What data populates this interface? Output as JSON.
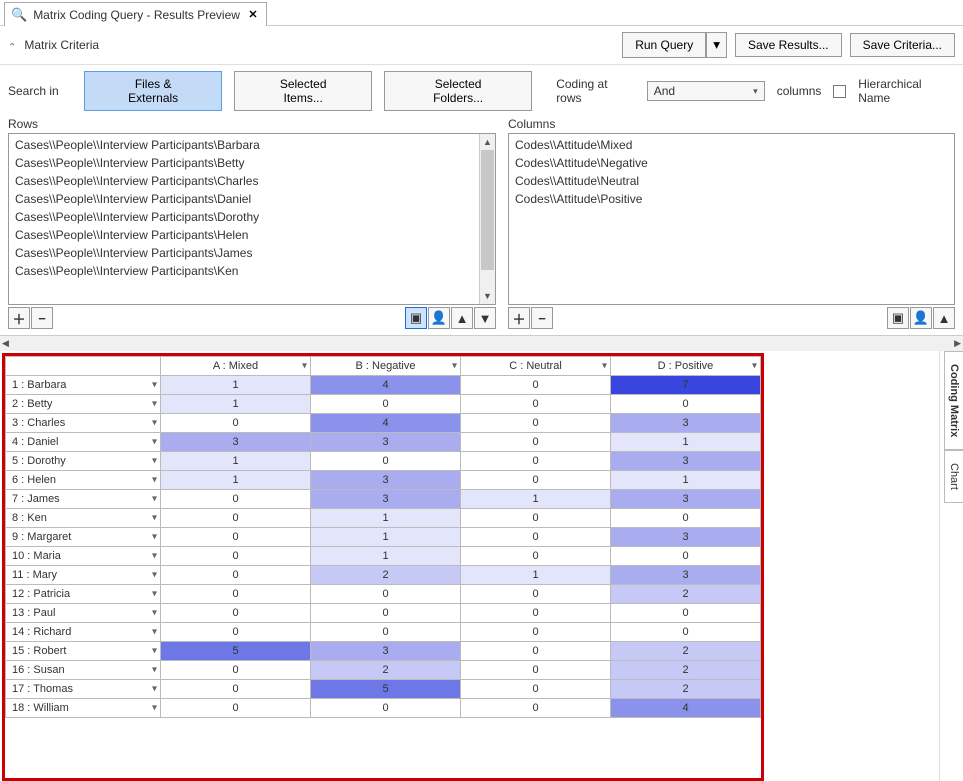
{
  "tab": {
    "title": "Matrix Coding Query - Results Preview"
  },
  "criteria": {
    "title": "Matrix Criteria"
  },
  "buttons": {
    "run_query": "Run Query",
    "save_results": "Save Results...",
    "save_criteria": "Save Criteria..."
  },
  "search": {
    "label": "Search in",
    "files": "Files & Externals",
    "selected_items": "Selected Items...",
    "selected_folders": "Selected Folders...",
    "coding_at_rows": "Coding at rows",
    "and": "And",
    "columns_word": "columns",
    "hierarchical_name": "Hierarchical Name"
  },
  "rows_title": "Rows",
  "cols_title": "Columns",
  "rows": [
    "Cases\\\\People\\\\Interview Participants\\Barbara",
    "Cases\\\\People\\\\Interview Participants\\Betty",
    "Cases\\\\People\\\\Interview Participants\\Charles",
    "Cases\\\\People\\\\Interview Participants\\Daniel",
    "Cases\\\\People\\\\Interview Participants\\Dorothy",
    "Cases\\\\People\\\\Interview Participants\\Helen",
    "Cases\\\\People\\\\Interview Participants\\James",
    "Cases\\\\People\\\\Interview Participants\\Ken"
  ],
  "cols": [
    "Codes\\\\Attitude\\Mixed",
    "Codes\\\\Attitude\\Negative",
    "Codes\\\\Attitude\\Neutral",
    "Codes\\\\Attitude\\Positive"
  ],
  "matrix": {
    "corner": "",
    "headers": [
      "A : Mixed",
      "B : Negative",
      "C : Neutral",
      "D : Positive"
    ],
    "row_labels": [
      "1 : Barbara",
      "2 : Betty",
      "3 : Charles",
      "4 : Daniel",
      "5 : Dorothy",
      "6 : Helen",
      "7 : James",
      "8 : Ken",
      "9 : Margaret",
      "10 : Maria",
      "11 : Mary",
      "12 : Patricia",
      "13 : Paul",
      "14 : Richard",
      "15 : Robert",
      "16 : Susan",
      "17 : Thomas",
      "18 : William"
    ],
    "cells": [
      [
        {
          "v": 1,
          "s": 1
        },
        {
          "v": 4,
          "s": 4
        },
        {
          "v": 0,
          "s": 0
        },
        {
          "v": 7,
          "s": 7
        }
      ],
      [
        {
          "v": 1,
          "s": 1
        },
        {
          "v": 0,
          "s": 0
        },
        {
          "v": 0,
          "s": 0
        },
        {
          "v": 0,
          "s": 0
        }
      ],
      [
        {
          "v": 0,
          "s": 0
        },
        {
          "v": 4,
          "s": 4
        },
        {
          "v": 0,
          "s": 0
        },
        {
          "v": 3,
          "s": 3
        }
      ],
      [
        {
          "v": 3,
          "s": 3
        },
        {
          "v": 3,
          "s": 3
        },
        {
          "v": 0,
          "s": 0
        },
        {
          "v": 1,
          "s": 1
        }
      ],
      [
        {
          "v": 1,
          "s": 1
        },
        {
          "v": 0,
          "s": 0
        },
        {
          "v": 0,
          "s": 0
        },
        {
          "v": 3,
          "s": 3
        }
      ],
      [
        {
          "v": 1,
          "s": 1
        },
        {
          "v": 3,
          "s": 3
        },
        {
          "v": 0,
          "s": 0
        },
        {
          "v": 1,
          "s": 1
        }
      ],
      [
        {
          "v": 0,
          "s": 0
        },
        {
          "v": 3,
          "s": 3
        },
        {
          "v": 1,
          "s": 1
        },
        {
          "v": 3,
          "s": 3
        }
      ],
      [
        {
          "v": 0,
          "s": 0
        },
        {
          "v": 1,
          "s": 1
        },
        {
          "v": 0,
          "s": 0
        },
        {
          "v": 0,
          "s": 0
        }
      ],
      [
        {
          "v": 0,
          "s": 0
        },
        {
          "v": 1,
          "s": 1
        },
        {
          "v": 0,
          "s": 0
        },
        {
          "v": 3,
          "s": 3
        }
      ],
      [
        {
          "v": 0,
          "s": 0
        },
        {
          "v": 1,
          "s": 1
        },
        {
          "v": 0,
          "s": 0
        },
        {
          "v": 0,
          "s": 0
        }
      ],
      [
        {
          "v": 0,
          "s": 0
        },
        {
          "v": 2,
          "s": 2
        },
        {
          "v": 1,
          "s": 1
        },
        {
          "v": 3,
          "s": 3
        }
      ],
      [
        {
          "v": 0,
          "s": 0
        },
        {
          "v": 0,
          "s": 0
        },
        {
          "v": 0,
          "s": 0
        },
        {
          "v": 2,
          "s": 2
        }
      ],
      [
        {
          "v": 0,
          "s": 0
        },
        {
          "v": 0,
          "s": 0
        },
        {
          "v": 0,
          "s": 0
        },
        {
          "v": 0,
          "s": 0
        }
      ],
      [
        {
          "v": 0,
          "s": 0
        },
        {
          "v": 0,
          "s": 0
        },
        {
          "v": 0,
          "s": 0
        },
        {
          "v": 0,
          "s": 0
        }
      ],
      [
        {
          "v": 5,
          "s": 5
        },
        {
          "v": 3,
          "s": 3
        },
        {
          "v": 0,
          "s": 0
        },
        {
          "v": 2,
          "s": 2
        }
      ],
      [
        {
          "v": 0,
          "s": 0
        },
        {
          "v": 2,
          "s": 2
        },
        {
          "v": 0,
          "s": 0
        },
        {
          "v": 2,
          "s": 2
        }
      ],
      [
        {
          "v": 0,
          "s": 0
        },
        {
          "v": 5,
          "s": 5
        },
        {
          "v": 0,
          "s": 0
        },
        {
          "v": 2,
          "s": 2
        }
      ],
      [
        {
          "v": 0,
          "s": 0
        },
        {
          "v": 0,
          "s": 0
        },
        {
          "v": 0,
          "s": 0
        },
        {
          "v": 4,
          "s": 4
        }
      ]
    ]
  },
  "side_tabs": {
    "coding_matrix": "Coding Matrix",
    "chart": "Chart"
  },
  "chart_data": {
    "type": "table",
    "title": "Matrix Coding Query - Results Preview",
    "rows": [
      "Barbara",
      "Betty",
      "Charles",
      "Daniel",
      "Dorothy",
      "Helen",
      "James",
      "Ken",
      "Margaret",
      "Maria",
      "Mary",
      "Patricia",
      "Paul",
      "Richard",
      "Robert",
      "Susan",
      "Thomas",
      "William"
    ],
    "columns": [
      "Mixed",
      "Negative",
      "Neutral",
      "Positive"
    ],
    "values": [
      [
        1,
        4,
        0,
        7
      ],
      [
        1,
        0,
        0,
        0
      ],
      [
        0,
        4,
        0,
        3
      ],
      [
        3,
        3,
        0,
        1
      ],
      [
        1,
        0,
        0,
        3
      ],
      [
        1,
        3,
        0,
        1
      ],
      [
        0,
        3,
        1,
        3
      ],
      [
        0,
        1,
        0,
        0
      ],
      [
        0,
        1,
        0,
        3
      ],
      [
        0,
        1,
        0,
        0
      ],
      [
        0,
        2,
        1,
        3
      ],
      [
        0,
        0,
        0,
        2
      ],
      [
        0,
        0,
        0,
        0
      ],
      [
        0,
        0,
        0,
        0
      ],
      [
        5,
        3,
        0,
        2
      ],
      [
        0,
        2,
        0,
        2
      ],
      [
        0,
        5,
        0,
        2
      ],
      [
        0,
        0,
        0,
        4
      ]
    ]
  }
}
